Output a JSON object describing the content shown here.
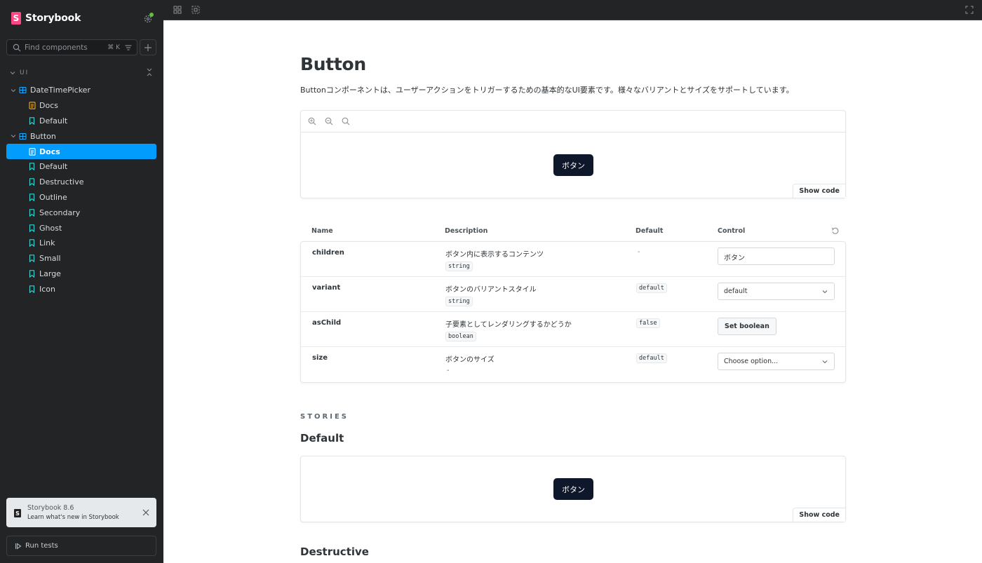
{
  "app": {
    "name": "Storybook",
    "logo_letter": "S"
  },
  "search": {
    "placeholder": "Find components",
    "shortcut": "⌘ K"
  },
  "sidebar": {
    "group_label": "UI",
    "components": [
      {
        "label": "DateTimePicker",
        "children": [
          "Docs",
          "Default"
        ]
      },
      {
        "label": "Button",
        "children": [
          "Docs",
          "Default",
          "Destructive",
          "Outline",
          "Secondary",
          "Ghost",
          "Link",
          "Small",
          "Large",
          "Icon"
        ]
      }
    ],
    "selected": "Button / Docs"
  },
  "notification": {
    "title": "Storybook 8.6",
    "subtitle": "Learn what's new in Storybook"
  },
  "run_tests": {
    "label": "Run tests"
  },
  "docs": {
    "title": "Button",
    "description": "Buttonコンポーネントは、ユーザーアクションをトリガーするための基本的なUI要素です。様々なバリアントとサイズをサポートしています。",
    "demo_button_label": "ボタン",
    "show_code_label": "Show code"
  },
  "args_table": {
    "headers": {
      "name": "Name",
      "description": "Description",
      "default": "Default",
      "control": "Control"
    },
    "rows": [
      {
        "name": "children",
        "description": "ボタン内に表示するコンテンツ",
        "type": "string",
        "default": "-",
        "control_value": "ボタン"
      },
      {
        "name": "variant",
        "description": "ボタンのバリアントスタイル",
        "type": "string",
        "default": "default",
        "control_value": "default"
      },
      {
        "name": "asChild",
        "description": "子要素としてレンダリングするかどうか",
        "type": "boolean",
        "default": "false",
        "control_value": "Set boolean"
      },
      {
        "name": "size",
        "description": "ボタンのサイズ",
        "type": "-",
        "default": "default",
        "control_value": "Choose option..."
      }
    ]
  },
  "stories": {
    "label": "STORIES",
    "items": [
      {
        "title": "Default",
        "button_label": "ボタン",
        "show_code_label": "Show code"
      },
      {
        "title": "Destructive"
      }
    ]
  },
  "colors": {
    "accent": "#029cfd",
    "brand": "#ff4785",
    "button_dark": "#0f172a",
    "sidebar_bg": "#222425"
  }
}
